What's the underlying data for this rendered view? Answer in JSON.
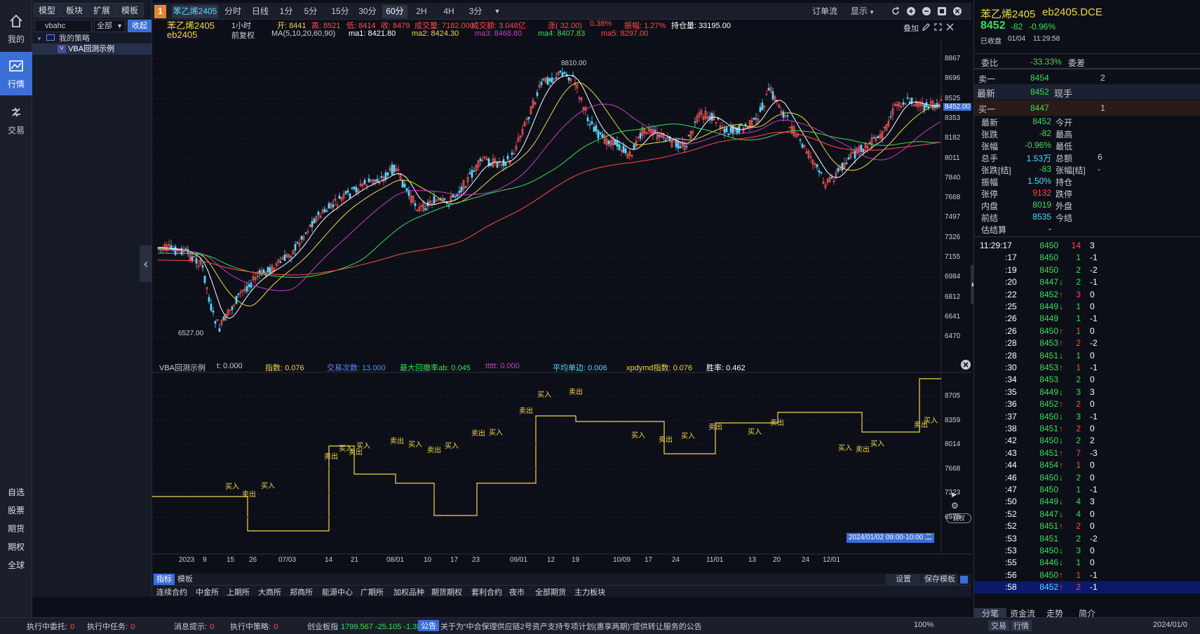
{
  "rail": {
    "items": [
      {
        "label": "我的",
        "icon": "home-icon"
      },
      {
        "label": "行情",
        "icon": "chart-icon"
      },
      {
        "label": "交易",
        "icon": "trade-icon"
      }
    ],
    "links": [
      "自选",
      "股票",
      "期货",
      "期权",
      "全球"
    ]
  },
  "tree": {
    "tabs": [
      "模型",
      "板块",
      "扩展",
      "模板"
    ],
    "search_value": "vbahc",
    "dropdown_value": "全部",
    "fold_label": "收起",
    "folder": "我的策略",
    "item": "VBA回测示例"
  },
  "toolbar": {
    "badge": "1",
    "symbol": "苯乙烯2405",
    "periods": [
      "分时",
      "日线",
      "1分",
      "5分",
      "15分",
      "30分",
      "60分",
      "2H",
      "4H",
      "3分"
    ],
    "active_period": "60分",
    "right": [
      "订单流",
      "显示"
    ]
  },
  "header": {
    "name": "苯乙烯2405",
    "code": "eb2405",
    "period": "1小时",
    "adj": "前复权",
    "ma_def": "MA(5,10,20,60,90)",
    "ohlc": [
      {
        "label": "开:",
        "value": "8441"
      },
      {
        "label": "高:",
        "value": "8521"
      },
      {
        "label": "低:",
        "value": "8414"
      },
      {
        "label": "收:",
        "value": "8479"
      },
      {
        "label": "成交量:",
        "value": "7182.000"
      },
      {
        "label": "成交额:",
        "value": "3.048亿"
      },
      {
        "label": "涨(",
        "value": "32.00)"
      },
      {
        "label": "",
        "value": "0.38%"
      },
      {
        "label": "振幅:",
        "value": "1.27%"
      },
      {
        "label": "持仓量:",
        "value": "33195.00"
      }
    ],
    "mas": [
      {
        "label": "ma1:",
        "value": "8421.80"
      },
      {
        "label": "ma2:",
        "value": "8424.30"
      },
      {
        "label": "ma3:",
        "value": "8468.80"
      },
      {
        "label": "ma4:",
        "value": "8407.83"
      },
      {
        "label": "ma5:",
        "value": "8297.00"
      }
    ],
    "overlay": "叠加"
  },
  "main_chart": {
    "y_ticks": [
      "8867",
      "8696",
      "8525",
      "8353",
      "8182",
      "8011",
      "7840",
      "7668",
      "7497",
      "7326",
      "7155",
      "6984",
      "6812",
      "6641",
      "6470"
    ],
    "high_label": "8810.00",
    "low_label": "6527.00",
    "last_price": "8452.00"
  },
  "indicator": {
    "name": "VBA回测示例",
    "stats": [
      {
        "label": "t:",
        "value": "0.000",
        "color": "#c8ccd6"
      },
      {
        "label": "指数:",
        "value": "0.076",
        "color": "#f0d74a"
      },
      {
        "label": "交易次数:",
        "value": "13.000",
        "color": "#5b8cff"
      },
      {
        "label": "最大回撤率ab:",
        "value": "0.045",
        "color": "#3ddc5b"
      },
      {
        "label": "ttttt:",
        "value": "0.000",
        "color": "#c040c0"
      },
      {
        "label": "平均单边:",
        "value": "0.006",
        "color": "#5ad8ff"
      },
      {
        "label": "xpdymd指数:",
        "value": "0.076",
        "color": "#f0d74a"
      },
      {
        "label": "胜率:",
        "value": "0.462",
        "color": "#ffffff"
      }
    ],
    "y_ticks": [
      "8705",
      "8359",
      "8014",
      "7668",
      "7323",
      "6978"
    ],
    "buy": "买入",
    "sell": "卖出",
    "adjust_btn": "调权"
  },
  "x_axis": [
    "2023",
    "9",
    "15",
    "26",
    "07/03",
    "14",
    "21",
    "08/01",
    "10",
    "17",
    "23",
    "09/01",
    "12",
    "19",
    "10/09",
    "17",
    "24",
    "11/01",
    "13",
    "20",
    "24",
    "12/01"
  ],
  "x_highlight": "2024/01/02 09:00-10:00 二",
  "bottom_tabs": [
    "指标",
    "模板"
  ],
  "bottom_buttons": [
    "设置",
    "保存模板"
  ],
  "bottom_nav": [
    "连续合约",
    "中金所",
    "上期所",
    "大商所",
    "郑商所",
    "能源中心",
    "广期所",
    "加权品种",
    "期货期权",
    "套利合约",
    "夜市",
    "全部期货",
    "主力板块"
  ],
  "quote": {
    "title": "苯乙烯2405",
    "code": "eb2405.DCE",
    "price": "8452",
    "change": "-82",
    "pct": "-0.96%",
    "status": "已收盘",
    "date": "01/04",
    "time": "11:29:58",
    "weibi_label": "委比",
    "weibi": "-33.33%",
    "weicha_label": "委差",
    "weicha": "2",
    "ask_label": "卖一",
    "ask": "8454",
    "ask_vol": "2",
    "last_label": "最新",
    "last": "8452",
    "hand_label": "现手",
    "bid_label": "买一",
    "bid": "8447",
    "bid_vol": "1",
    "stats": [
      {
        "l1": "最新",
        "v1": "8452",
        "c1": "green",
        "l2": "今开",
        "v2": ""
      },
      {
        "l1": "张跌",
        "v1": "-82",
        "c1": "green",
        "l2": "最高",
        "v2": ""
      },
      {
        "l1": "张幅",
        "v1": "-0.96%",
        "c1": "green",
        "l2": "最低",
        "v2": ""
      },
      {
        "l1": "总手",
        "v1": "1.53万",
        "c1": "cyan",
        "l2": "总额",
        "v2": "6"
      },
      {
        "l1": "张跌[结]",
        "v1": "-83",
        "c1": "green",
        "l2": "张幅[结]",
        "v2": "-"
      },
      {
        "l1": "振幅",
        "v1": "1.50%",
        "c1": "cyan",
        "l2": "持仓",
        "v2": ""
      },
      {
        "l1": "张停",
        "v1": "9132",
        "c1": "red",
        "l2": "跌停",
        "v2": ""
      },
      {
        "l1": "内盘",
        "v1": "8019",
        "c1": "green",
        "l2": "外盘",
        "v2": ""
      },
      {
        "l1": "前结",
        "v1": "8535",
        "c1": "cyan",
        "l2": "今结",
        "v2": ""
      },
      {
        "l1": "估结算",
        "v1": "-",
        "c1": "white",
        "l2": "",
        "v2": ""
      }
    ],
    "ticks": [
      {
        "t": "11:29:17",
        "p": "8450",
        "a": "",
        "v": "14",
        "vc": "red",
        "d": "3"
      },
      {
        "t": ":17",
        "p": "8450",
        "a": "",
        "v": "1",
        "vc": "green",
        "d": "-1"
      },
      {
        "t": ":19",
        "p": "8450",
        "a": "",
        "v": "2",
        "vc": "green",
        "d": "-2"
      },
      {
        "t": ":20",
        "p": "8447",
        "a": "↓",
        "v": "2",
        "vc": "green",
        "d": "-1"
      },
      {
        "t": ":22",
        "p": "8452",
        "a": "↑",
        "v": "3",
        "vc": "red",
        "d": "0"
      },
      {
        "t": ":25",
        "p": "8449",
        "a": "↓",
        "v": "1",
        "vc": "green",
        "d": "0"
      },
      {
        "t": ":26",
        "p": "8449",
        "a": "",
        "v": "1",
        "vc": "green",
        "d": "-1"
      },
      {
        "t": ":26",
        "p": "8450",
        "a": "↑",
        "v": "1",
        "vc": "red",
        "d": "0"
      },
      {
        "t": ":28",
        "p": "8453",
        "a": "↑",
        "v": "2",
        "vc": "red",
        "d": "-2"
      },
      {
        "t": ":28",
        "p": "8451",
        "a": "↓",
        "v": "1",
        "vc": "green",
        "d": "0"
      },
      {
        "t": ":30",
        "p": "8453",
        "a": "↑",
        "v": "1",
        "vc": "red",
        "d": "-1"
      },
      {
        "t": ":34",
        "p": "8453",
        "a": "",
        "v": "2",
        "vc": "green",
        "d": "0"
      },
      {
        "t": ":35",
        "p": "8449",
        "a": "↓",
        "v": "3",
        "vc": "green",
        "d": "3"
      },
      {
        "t": ":36",
        "p": "8452",
        "a": "↑",
        "v": "2",
        "vc": "red",
        "d": "0"
      },
      {
        "t": ":37",
        "p": "8450",
        "a": "↓",
        "v": "3",
        "vc": "green",
        "d": "-1"
      },
      {
        "t": ":38",
        "p": "8451",
        "a": "↑",
        "v": "2",
        "vc": "red",
        "d": "0"
      },
      {
        "t": ":42",
        "p": "8450",
        "a": "↓",
        "v": "2",
        "vc": "green",
        "d": "2"
      },
      {
        "t": ":43",
        "p": "8451",
        "a": "↑",
        "v": "7",
        "vc": "red",
        "d": "-3"
      },
      {
        "t": ":44",
        "p": "8454",
        "a": "↑",
        "v": "1",
        "vc": "red",
        "d": "0"
      },
      {
        "t": ":46",
        "p": "8450",
        "a": "↓",
        "v": "2",
        "vc": "green",
        "d": "0"
      },
      {
        "t": ":47",
        "p": "8450",
        "a": "",
        "v": "1",
        "vc": "green",
        "d": "-1"
      },
      {
        "t": ":50",
        "p": "8449",
        "a": "↓",
        "v": "4",
        "vc": "green",
        "d": "3"
      },
      {
        "t": ":52",
        "p": "8447",
        "a": "↓",
        "v": "4",
        "vc": "green",
        "d": "0"
      },
      {
        "t": ":52",
        "p": "8451",
        "a": "↑",
        "v": "2",
        "vc": "red",
        "d": "0"
      },
      {
        "t": ":53",
        "p": "8451",
        "a": "",
        "v": "2",
        "vc": "green",
        "d": "-2"
      },
      {
        "t": ":53",
        "p": "8450",
        "a": "↓",
        "v": "3",
        "vc": "green",
        "d": "0"
      },
      {
        "t": ":55",
        "p": "8446",
        "a": "↓",
        "v": "1",
        "vc": "green",
        "d": "0"
      },
      {
        "t": ":56",
        "p": "8450",
        "a": "↑",
        "v": "1",
        "vc": "red",
        "d": "-1"
      },
      {
        "t": ":58",
        "p": "8452",
        "a": "↑",
        "v": "2",
        "vc": "red",
        "d": "-1"
      }
    ],
    "bottom_tabs": [
      "分笔",
      "资金流",
      "走势",
      "简介"
    ]
  },
  "status": {
    "items": [
      {
        "label": "执行中委托:",
        "value": "0"
      },
      {
        "label": "执行中任务:",
        "value": "0"
      },
      {
        "label": "消息提示:",
        "value": "0"
      },
      {
        "label": "执行中策略:",
        "value": "0"
      },
      {
        "label": "创业板指",
        "value": "1799.567 -25.105 -1.38%"
      }
    ],
    "notice_tag": "公告",
    "notice": "关于为“中合保理供应链2号资产支持专项计划(惠享两期)”提供转让服务的公告",
    "zoom": "100%",
    "right_tabs": [
      "交易",
      "行情"
    ],
    "date": "2024/01/0"
  }
}
